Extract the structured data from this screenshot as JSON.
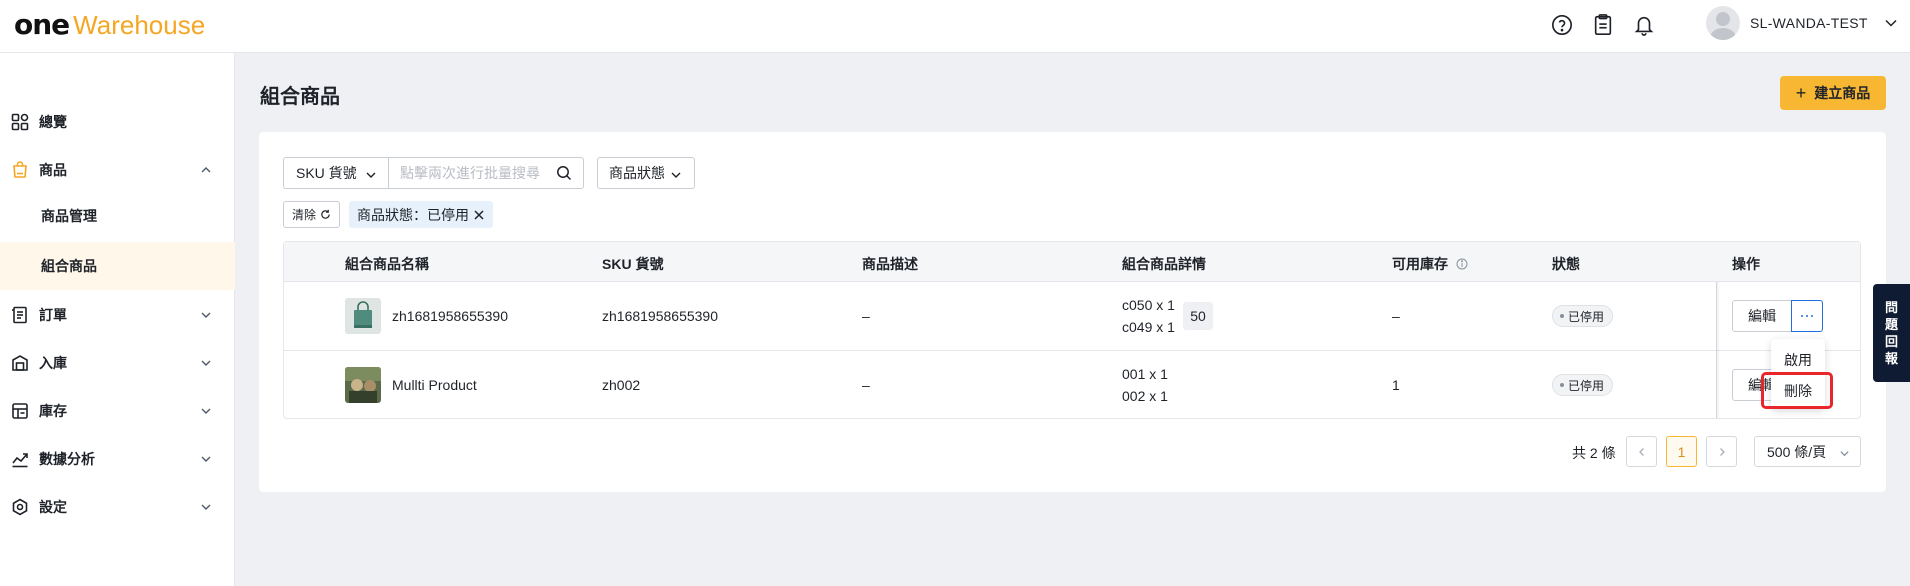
{
  "header": {
    "logo_prefix": "one",
    "logo_suffix": "Warehouse",
    "username": "SL-WANDA-TEST",
    "icons": [
      "help-circle-icon",
      "clipboard-icon",
      "bell-icon",
      "avatar",
      "chevron-down-icon"
    ]
  },
  "sidebar": {
    "items": [
      {
        "label": "總覽",
        "icon": "dashboard-icon"
      },
      {
        "label": "商品",
        "icon": "product-bag-icon",
        "expanded": true
      },
      {
        "label": "商品管理"
      },
      {
        "label": "組合商品",
        "active": true
      },
      {
        "label": "訂單",
        "icon": "order-icon"
      },
      {
        "label": "入庫",
        "icon": "inbound-icon"
      },
      {
        "label": "庫存",
        "icon": "inventory-icon"
      },
      {
        "label": "數據分析",
        "icon": "analytics-icon"
      },
      {
        "label": "設定",
        "icon": "settings-icon"
      }
    ]
  },
  "page": {
    "title": "組合商品",
    "create_button": "建立商品"
  },
  "filters": {
    "sku_select": "SKU 貨號",
    "search_placeholder": "點擊兩次進行批量搜尋",
    "status_select": "商品狀態",
    "clear": "清除",
    "active_tag": "商品狀態：已停用"
  },
  "table": {
    "columns": [
      "組合商品名稱",
      "SKU 貨號",
      "商品描述",
      "組合商品詳情",
      "可用庫存",
      "狀態",
      "操作"
    ],
    "rows": [
      {
        "name": "zh1681958655390",
        "sku": "zh1681958655390",
        "description": "–",
        "details": [
          "c050 x 1",
          "c049 x 1"
        ],
        "details_badge": "50",
        "stock": "–",
        "status": "已停用",
        "edit": "編輯"
      },
      {
        "name": "Mullti Product",
        "sku": "zh002",
        "description": "–",
        "details": [
          "001 x 1",
          "002 x 1"
        ],
        "stock": "1",
        "status": "已停用",
        "edit": "編輯"
      }
    ]
  },
  "dropdown": {
    "items": [
      "啟用",
      "刪除"
    ]
  },
  "pagination": {
    "total": "共 2 條",
    "current_page": "1",
    "page_size": "500 條/頁"
  },
  "feedback": {
    "chars": [
      "問",
      "題",
      "回",
      "報"
    ]
  },
  "colors": {
    "accent": "#f7b733",
    "logo_orange": "#f5a623",
    "link_blue": "#1f6fe0",
    "highlight_red": "#e8262b",
    "feedback_bg": "#0f1b33"
  }
}
